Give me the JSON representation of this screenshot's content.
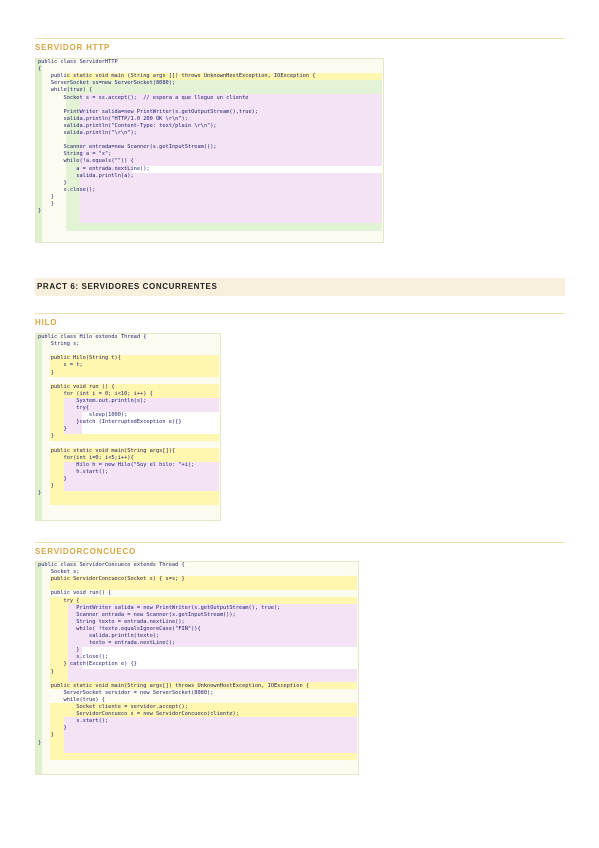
{
  "sections": {
    "servidor_http": {
      "title": "SERVIDOR HTTP",
      "lines": [
        "public class ServidorHTTP",
        "{",
        "    public static void main (String args []) throws UnknownHostException, IOException {",
        "    ServerSocket ss=new ServerSocket(8080);",
        "    while(true) {",
        "        Socket s = ss.accept();  // espera a que llegue un cliente",
        "",
        "        PrintWriter salida=new PrintWriter(s.getOutputStream(),true);",
        "        salida.println(\"HTTP/1.0 200 OK \\r\\n\");",
        "        salida.println(\"Content-Type: text/plain \\r\\n\");",
        "        salida.println(\"\\r\\n\");",
        "",
        "        Scanner entrada=new Scanner(s.getInputStream());",
        "        String a = \"x\";",
        "        while(!a.equals(\"\")) {",
        "            a = entrada.nextLine();",
        "            salida.println(a);",
        "        }",
        "        s.close();",
        "    }",
        "    }",
        "}"
      ]
    },
    "pract6": {
      "title": "PRACT 6: SERVIDORES CONCURRENTES"
    },
    "hilo": {
      "title": "HILO",
      "lines": [
        "public class Hilo extends Thread {",
        "    String s;",
        "",
        "    public Hilo(String t){",
        "        s = t;",
        "    }",
        "",
        "    public void run () {",
        "        for (int i = 0; i<10; i++) {",
        "            System.out.println(s);",
        "            try{",
        "                sleep(1000);",
        "            }catch (InterruptedException e){}",
        "        }",
        "    }",
        "",
        "    public static void main(String args[]){",
        "        for(int i=0; i<5;i++){",
        "            Hilo h = new Hilo(\"Soy el hilo: \"+i);",
        "            h.start();",
        "        }",
        "    }",
        "}"
      ]
    },
    "servidorconcueco": {
      "title": "SERVIDORCONCUECO",
      "lines": [
        "public class ServidorConcueco extends Thread {",
        "    Socket s;",
        "    public ServidorConcueco(Socket s) { s=s; }",
        "",
        "    public void run() {",
        "        try {",
        "            PrintWriter salida = new PrintWriter(s.getOutputStream(), true);",
        "            Scanner entrada = new Scanner(s.getInputStream());",
        "            String texto = entrada.nextLine();",
        "            while( !texto.equalsIgnoreCase(\"FIN\")){",
        "                salida.println(texto);",
        "                texto = entrada.nextLine();",
        "            }",
        "            s.close();",
        "        } catch(Exception e) {}",
        "    }",
        "",
        "    public static void main(String args[]) throws UnknownHostException, IOException {",
        "        ServerSocket servidor = new ServerSocket(8080);",
        "        while(true) {",
        "            Socket cliente = servidor.accept();",
        "            ServidorConcueco s = new ServidorConcueco(cliente);",
        "            s.start();",
        "        }",
        "    }",
        "}"
      ]
    }
  }
}
